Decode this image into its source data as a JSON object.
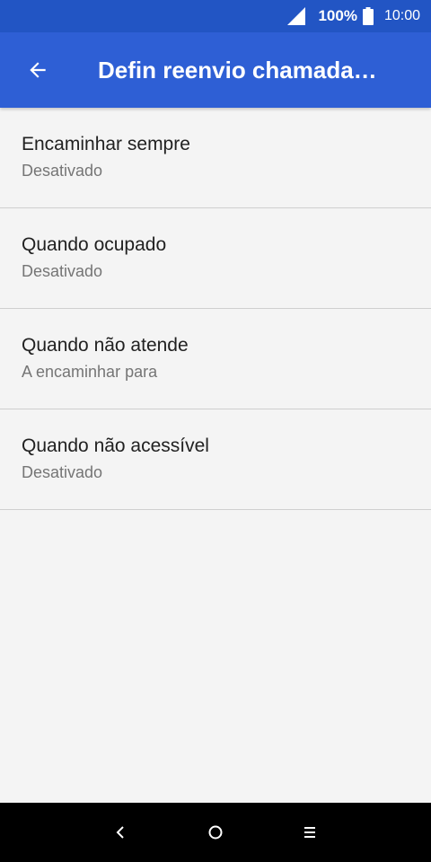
{
  "status_bar": {
    "signal_icon": "signal-full-icon",
    "battery_percent": "100%",
    "battery_icon": "battery-full-icon",
    "time": "10:00"
  },
  "app_bar": {
    "back_icon": "arrow-back-icon",
    "title": "Defin reenvio chamada…"
  },
  "forwarding_options": [
    {
      "title": "Encaminhar sempre",
      "summary": "Desativado"
    },
    {
      "title": "Quando ocupado",
      "summary": "Desativado"
    },
    {
      "title": "Quando não atende",
      "summary": "A encaminhar para"
    },
    {
      "title": "Quando não acessível",
      "summary": "Desativado"
    }
  ],
  "nav_bar": {
    "back": "nav-back-icon",
    "home": "nav-home-icon",
    "menu": "nav-menu-icon"
  },
  "colors": {
    "status_bar": "#2255c4",
    "app_bar": "#2e5fd5",
    "background": "#f4f4f4",
    "nav_bar": "#000000"
  }
}
